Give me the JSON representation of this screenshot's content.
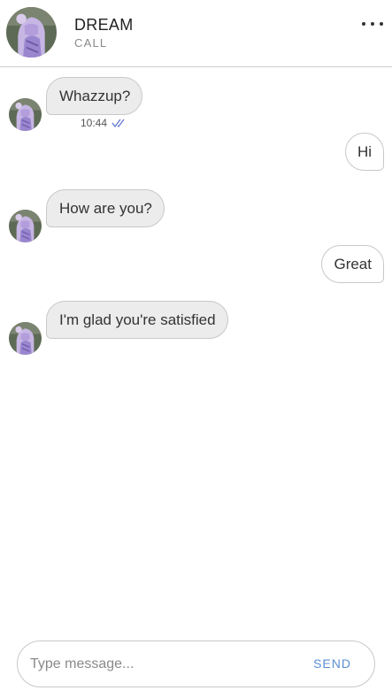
{
  "header": {
    "contact_name": "DREAM",
    "contact_status": "CALL",
    "avatar_icon": "contact-avatar"
  },
  "messages": [
    {
      "direction": "in",
      "text": "Whazzup?",
      "time": "10:44",
      "read_icon": "double-check-icon"
    },
    {
      "direction": "out",
      "text": "Hi"
    },
    {
      "direction": "in",
      "text": "How are you?"
    },
    {
      "direction": "out",
      "text": "Great"
    },
    {
      "direction": "in",
      "text": "I'm glad you're satisfied"
    }
  ],
  "composer": {
    "placeholder": "Type message...",
    "value": "",
    "send_label": "SEND"
  },
  "colors": {
    "send": "#5b8fd0",
    "incoming_bubble": "#ececec",
    "check": "#5a6fd0"
  }
}
